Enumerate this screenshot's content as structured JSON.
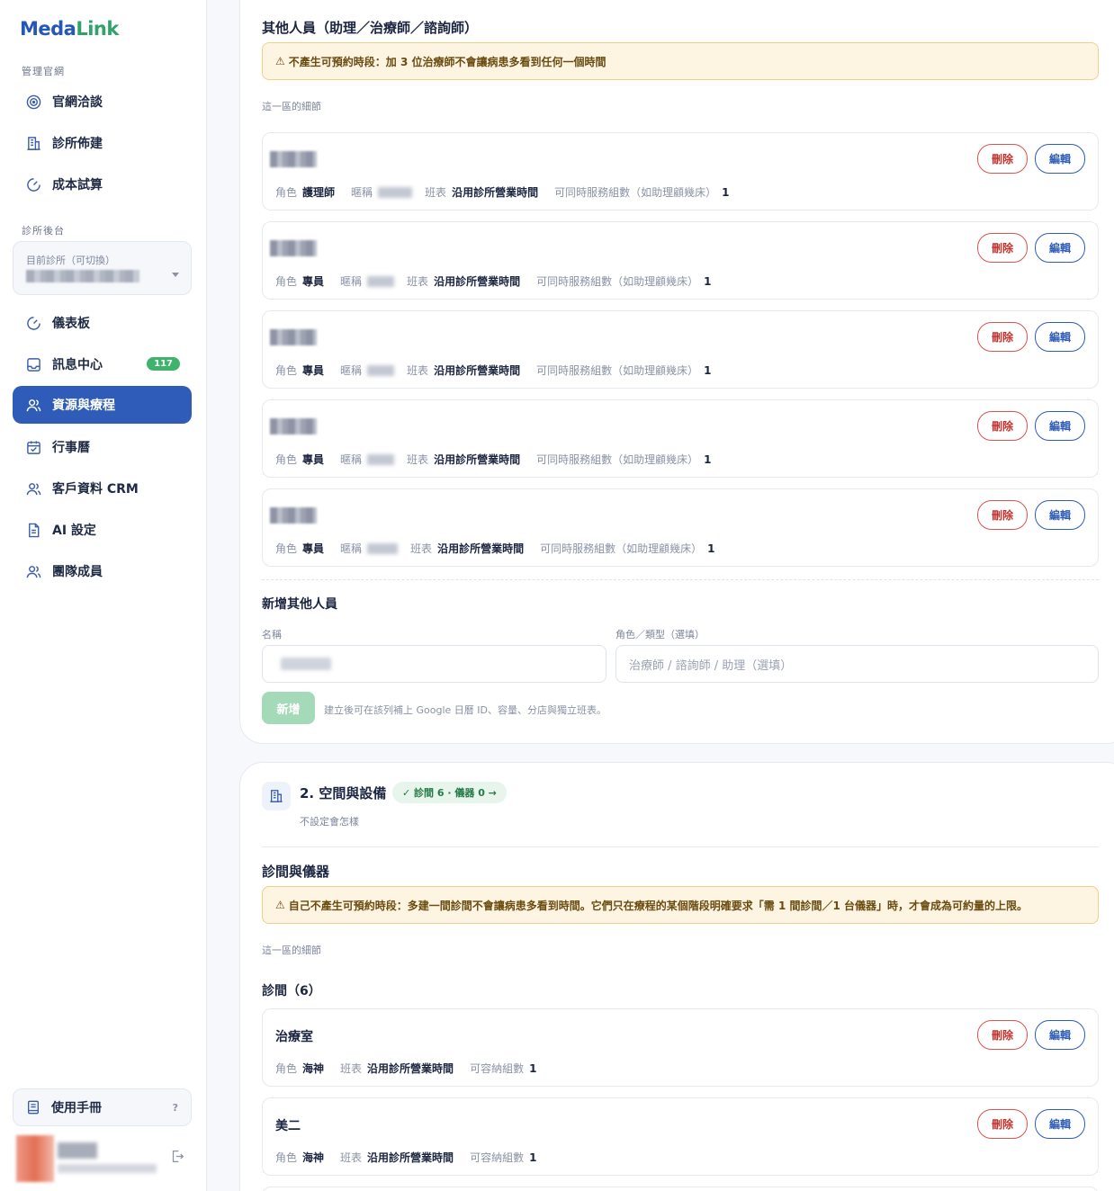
{
  "logo": {
    "part1": "Meda",
    "part2": "Link"
  },
  "sidebar": {
    "section1_label": "管理官網",
    "section1_items": [
      {
        "label": "官網洽談"
      },
      {
        "label": "診所佈建"
      },
      {
        "label": "成本試算"
      }
    ],
    "section2_label": "診所後台",
    "clinic_switch_label": "目前診所（可切換）",
    "section2_items": [
      {
        "label": "儀表板"
      },
      {
        "label": "訊息中心",
        "badge": "117"
      },
      {
        "label": "資源與療程"
      },
      {
        "label": "行事曆"
      },
      {
        "label": "客戶資料 CRM"
      },
      {
        "label": "AI 設定"
      },
      {
        "label": "團隊成員"
      }
    ],
    "manual_label": "使用手冊",
    "manual_help": "?"
  },
  "staff_section": {
    "title": "其他人員（助理／治療師／諮詢師）",
    "warning": "不產生可預約時段：加 3 位治療師不會讓病患多看到任何一個時間",
    "details": "這一區的細節",
    "rows": [
      {
        "role_label": "角色",
        "role": "護理師",
        "nick_label": "暱稱",
        "shift_label": "班表",
        "shift": "沿用診所營業時間",
        "capacity_label": "可同時服務組數（如助理顧幾床）",
        "capacity": "1"
      },
      {
        "role_label": "角色",
        "role": "專員",
        "nick_label": "暱稱",
        "shift_label": "班表",
        "shift": "沿用診所營業時間",
        "capacity_label": "可同時服務組數（如助理顧幾床）",
        "capacity": "1"
      },
      {
        "role_label": "角色",
        "role": "專員",
        "nick_label": "暱稱",
        "shift_label": "班表",
        "shift": "沿用診所營業時間",
        "capacity_label": "可同時服務組數（如助理顧幾床）",
        "capacity": "1"
      },
      {
        "role_label": "角色",
        "role": "專員",
        "nick_label": "暱稱",
        "shift_label": "班表",
        "shift": "沿用診所營業時間",
        "capacity_label": "可同時服務組數（如助理顧幾床）",
        "capacity": "1"
      },
      {
        "role_label": "角色",
        "role": "專員",
        "nick_label": "暱稱",
        "shift_label": "班表",
        "shift": "沿用診所營業時間",
        "capacity_label": "可同時服務組數（如助理顧幾床）",
        "capacity": "1"
      }
    ],
    "delete_label": "刪除",
    "edit_label": "編輯",
    "add_title": "新增其他人員",
    "name_label": "名稱",
    "role_field_label": "角色／類型（選填）",
    "role_placeholder": "治療師 / 諮詢師 / 助理（選填）",
    "add_button": "新增",
    "add_hint": "建立後可在該列補上 Google 日曆 ID、容量、分店與獨立班表。"
  },
  "space_section": {
    "number_title": "2. 空間與設備",
    "pill": "✓ 診間 6 · 儀器 0 →",
    "subtitle": "不設定會怎樣",
    "heading": "診間與儀器",
    "warning": "自己不產生可預約時段：多建一間診間不會讓病患多看到時間。它們只在療程的某個階段明確要求「需 1 間診間／1 台儀器」時，才會成為可約量的上限。",
    "details": "這一區的細節",
    "rooms_title": "診間（6）",
    "rooms": [
      {
        "name": "治療室",
        "role_label": "角色",
        "role": "海神",
        "shift_label": "班表",
        "shift": "沿用診所營業時間",
        "capacity_label": "可容納組數",
        "capacity": "1"
      },
      {
        "name": "美二",
        "role_label": "角色",
        "role": "海神",
        "shift_label": "班表",
        "shift": "沿用診所營業時間",
        "capacity_label": "可容納組數",
        "capacity": "1"
      }
    ]
  },
  "colors": {
    "primary": "#2e5cb8",
    "success": "#3fb26b",
    "danger": "#d9534f",
    "warning_bg": "#fdf5e2"
  }
}
